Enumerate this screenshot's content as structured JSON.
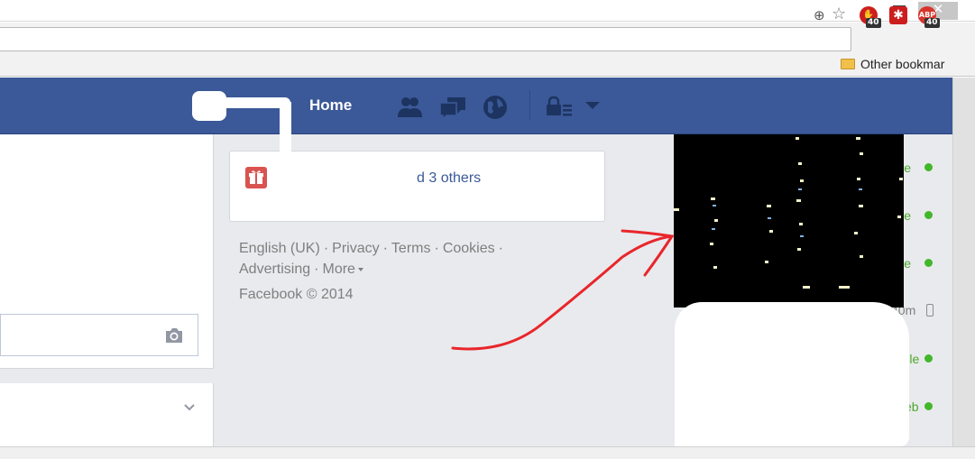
{
  "browser": {
    "window_buttons": {
      "minimize": "–",
      "maximize": "",
      "close": "✕"
    },
    "toolbar": {
      "zoom_icon": "zoom-icon",
      "bookmark_icon": "star-icon"
    },
    "extensions": [
      {
        "name": "stop-extension-icon",
        "glyph": "✋",
        "badge": "40",
        "color": "#cc1e1e"
      },
      {
        "name": "lastpass-extension-icon",
        "glyph": "✱",
        "badge": "",
        "color": "#cc1e1e"
      },
      {
        "name": "adblock-plus-extension-icon",
        "glyph": "ABP",
        "badge": "40",
        "color": "#d9342b"
      }
    ],
    "bookmarks_bar": {
      "other_bookmarks": "Other bookmar"
    }
  },
  "header": {
    "home_label": "Home",
    "icons": [
      "friend-requests-icon",
      "messages-icon",
      "notifications-icon",
      "privacy-shortcuts-icon",
      "account-menu-caret-icon"
    ],
    "brand_color": "#3b5998"
  },
  "birthday_card": {
    "text": "d 3 others"
  },
  "footer": {
    "links": [
      "English (UK)",
      "Privacy",
      "Terms",
      "Cookies",
      "Advertising",
      "More"
    ],
    "separator": "·",
    "copyright": "Facebook © 2014"
  },
  "chat": {
    "statuses": [
      {
        "label": "ile",
        "kind": "online"
      },
      {
        "label": "ile",
        "kind": "online"
      },
      {
        "label": "ile",
        "kind": "online"
      },
      {
        "label": "40m",
        "kind": "idle-mobile"
      },
      {
        "label": "Mobile",
        "kind": "online"
      },
      {
        "label": "Web",
        "kind": "online"
      }
    ],
    "online_color": "#42b72a"
  }
}
